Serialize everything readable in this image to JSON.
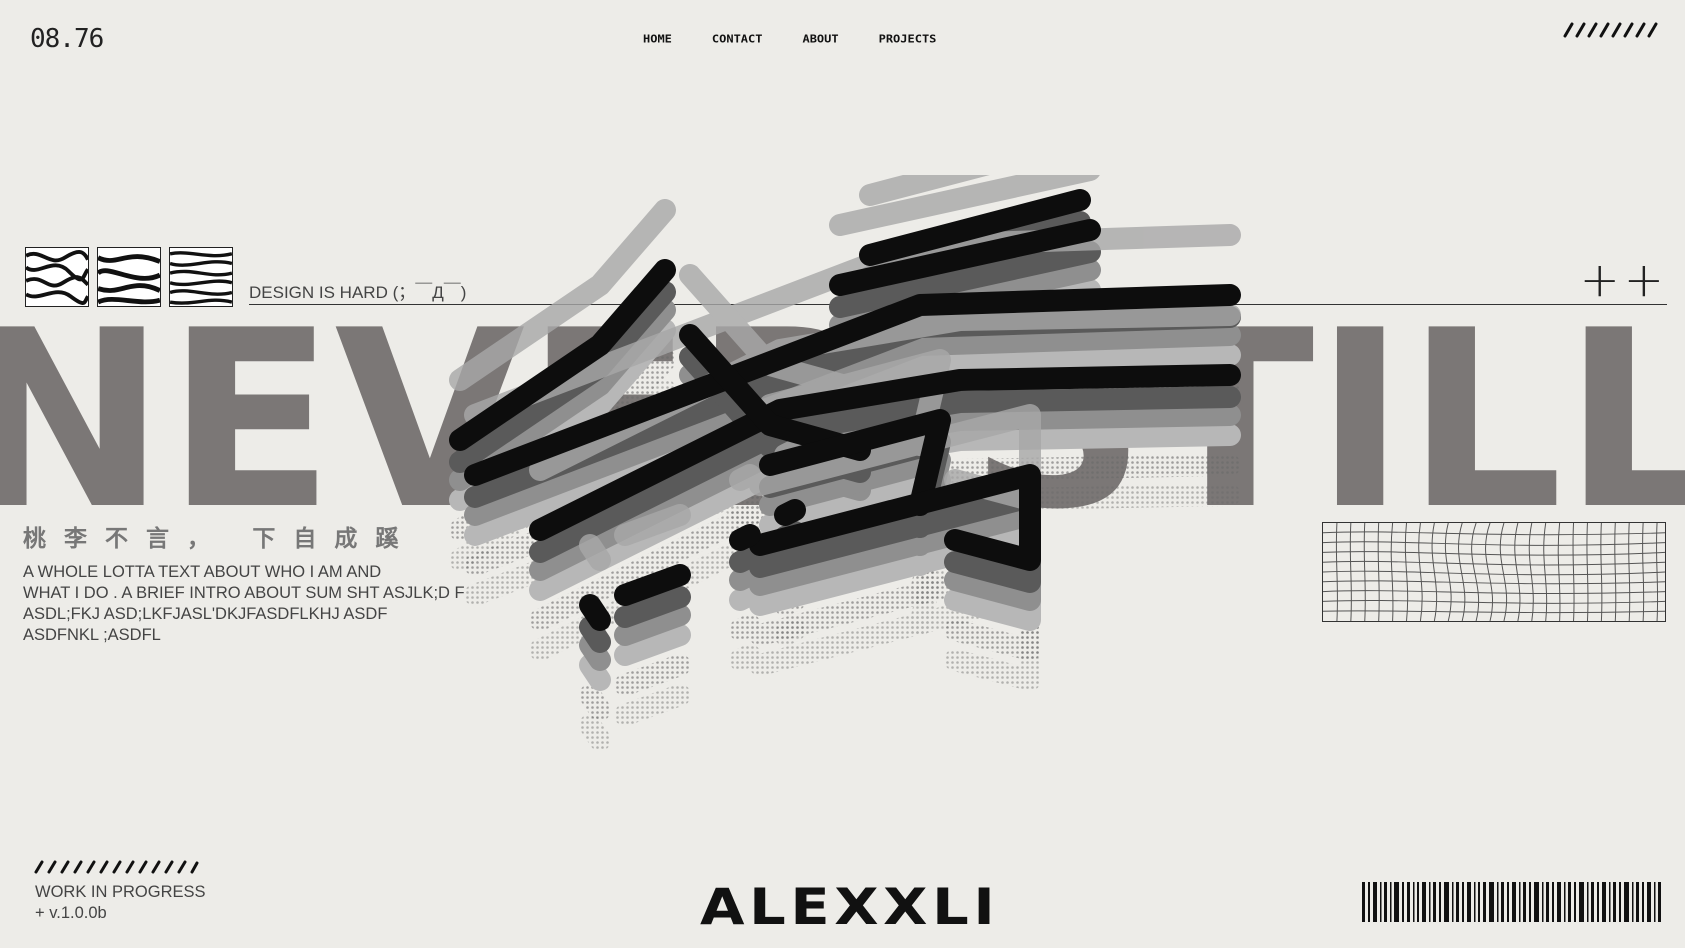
{
  "clock": "08.76",
  "nav": [
    {
      "label": "Home"
    },
    {
      "label": "Contact"
    },
    {
      "label": "About"
    },
    {
      "label": "Projects"
    }
  ],
  "tagline": "DESIGN IS HARD (；￣Д￣)",
  "plus_marks": "++",
  "big_text": "NEVER STILL",
  "chinese_line": "桃李不言， 下自成蹊",
  "intro_lines": [
    "A WHOLE LOTTA TEXT ABOUT WHO I AM AND",
    "WHAT I DO . A BRIEF INTRO ABOUT SUM SHT ASJLK;D F",
    "ASDL;FKJ ASD;LKFJASL'DKJFASDFLKHJ ASDF",
    "ASDFNKL ;ASDFL"
  ],
  "status": {
    "line1": "WORK IN PROGRESS",
    "line2": "+ v.1.0.0b"
  },
  "logo": "ALEXXLI",
  "colors": {
    "background": "#edece8",
    "ink": "#111111",
    "big_gray": "#7b7776"
  }
}
